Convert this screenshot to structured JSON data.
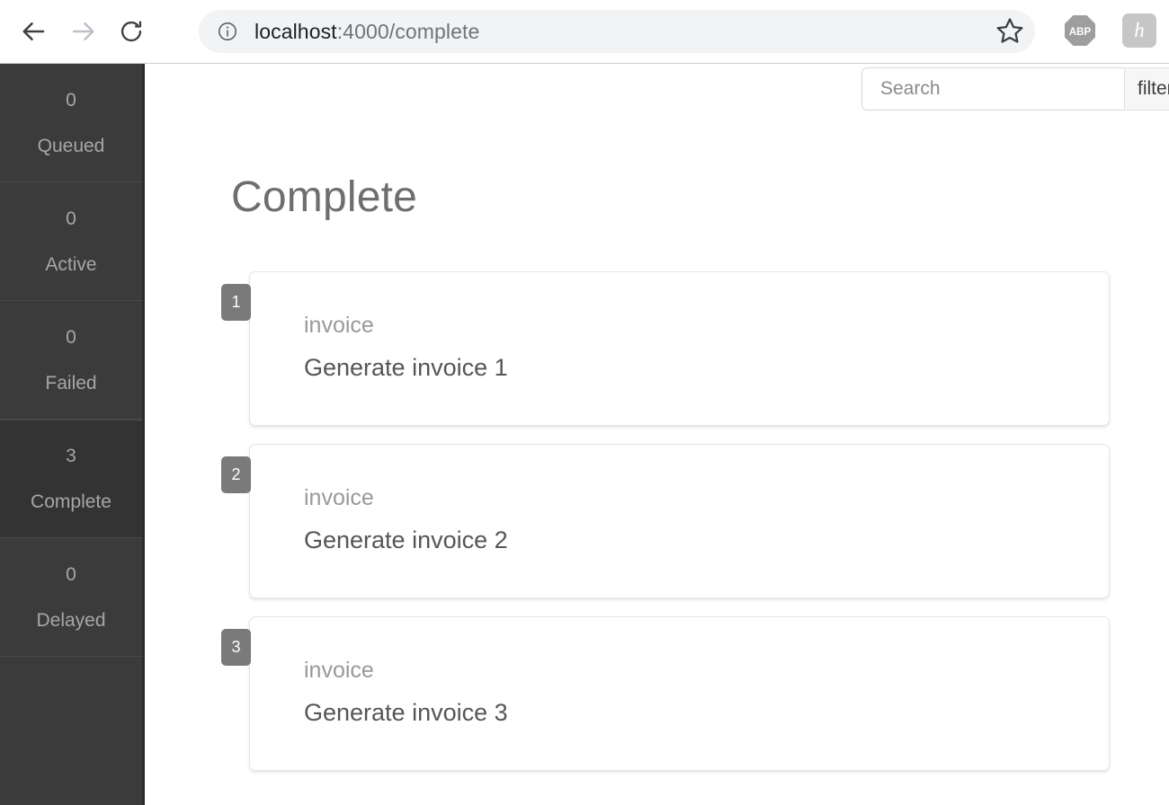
{
  "browser": {
    "back_label": "Back",
    "forward_label": "Forward",
    "reload_label": "Reload",
    "url_host": "localhost",
    "url_rest": ":4000/complete",
    "info_icon": "info-circle-icon",
    "star_icon": "bookmark-star-icon",
    "extensions": [
      {
        "name": "adblock-plus",
        "label": "ABP"
      },
      {
        "name": "honey",
        "label": "h"
      }
    ]
  },
  "sidebar": {
    "items": [
      {
        "count": "0",
        "label": "Queued",
        "active": false
      },
      {
        "count": "0",
        "label": "Active",
        "active": false
      },
      {
        "count": "0",
        "label": "Failed",
        "active": false
      },
      {
        "count": "3",
        "label": "Complete",
        "active": true
      },
      {
        "count": "0",
        "label": "Delayed",
        "active": false
      }
    ]
  },
  "toolbar": {
    "search_placeholder": "Search",
    "search_value": "",
    "filter_label": "filter"
  },
  "main": {
    "title": "Complete",
    "jobs": [
      {
        "badge": "1",
        "type": "invoice",
        "name": "Generate invoice 1"
      },
      {
        "badge": "2",
        "type": "invoice",
        "name": "Generate invoice 2"
      },
      {
        "badge": "3",
        "type": "invoice",
        "name": "Generate invoice 3"
      }
    ]
  },
  "colors": {
    "sidebar_bg": "#3b3b3b",
    "sidebar_active_bg": "#333333",
    "badge_bg": "#7a7a7a",
    "title_text": "#6e6e6e"
  }
}
